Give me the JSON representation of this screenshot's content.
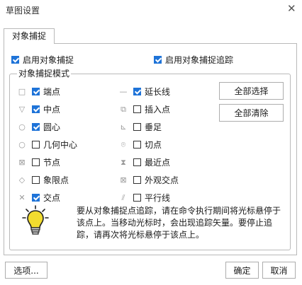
{
  "window": {
    "title": "草图设置",
    "close_symbol": "✕"
  },
  "tabs": [
    {
      "label": "对象捕捉"
    }
  ],
  "top_options": {
    "enable_snap": {
      "label": "启用对象捕捉",
      "checked": true
    },
    "enable_tracking": {
      "label": "启用对象捕捉追踪",
      "checked": true
    }
  },
  "group": {
    "title": "对象捕捉模式",
    "left_col": [
      {
        "label": "端点",
        "icon": "endpoint-marker-icon",
        "glyph": "□",
        "checked": true
      },
      {
        "label": "中点",
        "icon": "midpoint-marker-icon",
        "glyph": "▽",
        "checked": true
      },
      {
        "label": "圆心",
        "icon": "center-marker-icon",
        "glyph": "○",
        "checked": true
      },
      {
        "label": "几何中心",
        "icon": "geometric-center-marker-icon",
        "glyph": "○",
        "checked": false
      },
      {
        "label": "节点",
        "icon": "node-marker-icon",
        "glyph": "⊠",
        "checked": false
      },
      {
        "label": "象限点",
        "icon": "quadrant-marker-icon",
        "glyph": "◇",
        "checked": false
      },
      {
        "label": "交点",
        "icon": "intersection-marker-icon",
        "glyph": "✕",
        "checked": true
      }
    ],
    "right_col": [
      {
        "label": "延长线",
        "icon": "extension-marker-icon",
        "glyph": "—",
        "checked": true
      },
      {
        "label": "插入点",
        "icon": "insertion-marker-icon",
        "glyph": "⧉",
        "checked": false
      },
      {
        "label": "垂足",
        "icon": "perpendicular-marker-icon",
        "glyph": "⊾",
        "checked": false
      },
      {
        "label": "切点",
        "icon": "tangent-marker-icon",
        "glyph": "⌾",
        "checked": false
      },
      {
        "label": "最近点",
        "icon": "nearest-marker-icon",
        "glyph": "⧗",
        "checked": false
      },
      {
        "label": "外观交点",
        "icon": "apparent-intersection-marker-icon",
        "glyph": "⊠",
        "checked": false
      },
      {
        "label": "平行线",
        "icon": "parallel-marker-icon",
        "glyph": "⫽",
        "checked": false
      }
    ],
    "select_all_label": "全部选择",
    "clear_all_label": "全部清除"
  },
  "hint": {
    "icon": "lightbulb-icon",
    "text": "要从对象捕捉点追踪，请在命令执行期间将光标悬停于该点上。当移动光标时，会出现追踪矢量。要停止追踪，请再次将光标悬停于该点上。"
  },
  "footer": {
    "options_label": "选项...",
    "ok_label": "确定",
    "cancel_label": "取消"
  },
  "colors": {
    "checkbox_checked": "#1e73d8",
    "border": "#b9b9b9",
    "bulb_fill": "#f2dc2f"
  }
}
